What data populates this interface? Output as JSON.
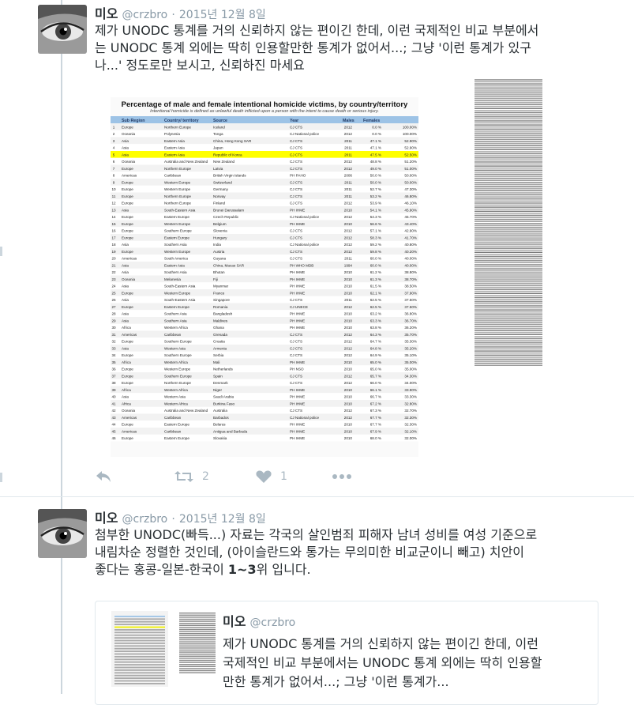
{
  "tweets": [
    {
      "name": "미오",
      "handle": "@crzbro",
      "date": "2015년 12월 8일",
      "lines": [
        "제가 UNODC 통계를 거의 신뢰하지 않는 편이긴 한데, 이런 국제적인 비교 부분에서",
        "는 UNODC 통계 외에는 딱히 인용할만한 통계가 없어서...; 그냥 '이런 통계가 있구",
        "나...' 정도로만 보시고, 신뢰하진 마세요"
      ],
      "retweets": "2",
      "likes": "1"
    },
    {
      "name": "미오",
      "handle": "@crzbro",
      "date": "2015년 12월 8일",
      "line1": "첨부한 UNODC(빠득...) 자료는 각국의 살인범죄 피해자 남녀 성비를 여성 기준으로",
      "line2": "내림차순 정렬한 것인데, (아이슬란드와 통가는 무의미한 비교군이니 빼고) 치안이",
      "line3_prefix": "좋다는 홍콩-일본-한국이 ",
      "line3_bold": "1~3",
      "line3_suffix": "위 입니다."
    }
  ],
  "quote": {
    "name": "미오",
    "handle": "@crzbro",
    "lines": [
      "제가 UNODC 통계를 거의 신뢰하지 않는 편이긴 한데, 이런",
      "국제적인 비교 부분에서는 UNODC 통계 외에는 딱히 인용할",
      "만한 통계가 없어서...; 그냥 '이런 통계가..."
    ]
  },
  "table": {
    "title": "Percentage of male and female intentional homicide victims, by country/territory",
    "subtitle": "Intentional homicide is defined as unlawful death inflicted upon a person with the intent to cause death or serious injury.",
    "headers": [
      "",
      "Sub Region",
      "Country/ territory",
      "Source",
      "Year",
      "Males",
      "Females"
    ],
    "highlight_row": 5,
    "rows": [
      [
        "1",
        "Europe",
        "Northern Europe",
        "Iceland",
        "CJ CTS",
        "2012",
        "0.0 %",
        "100.00%"
      ],
      [
        "2",
        "Oceania",
        "Polynesia",
        "Tonga",
        "CJ National police",
        "2012",
        "0.0 %",
        "100.00%"
      ],
      [
        "3",
        "Asia",
        "Eastern Asia",
        "China, Hong Kong SAR",
        "CJ CTS",
        "2011",
        "47.1 %",
        "52.90%"
      ],
      [
        "4",
        "Asia",
        "Eastern Asia",
        "Japan",
        "CJ CTS",
        "2011",
        "47.1 %",
        "52.90%"
      ],
      [
        "5",
        "Asia",
        "Eastern Asia",
        "Republic of Korea",
        "CJ CTS",
        "2011",
        "47.5 %",
        "52.50%"
      ],
      [
        "6",
        "Oceania",
        "Australia and New Zealand",
        "New Zealand",
        "CJ CTS",
        "2012",
        "48.8 %",
        "51.20%"
      ],
      [
        "7",
        "Europe",
        "Northern Europe",
        "Latvia",
        "CJ CTS",
        "2012",
        "49.0 %",
        "51.00%"
      ],
      [
        "8",
        "Americas",
        "Caribbean",
        "British Virgin Islands",
        "PH PAHO",
        "2006",
        "50.0 %",
        "50.00%"
      ],
      [
        "9",
        "Europe",
        "Western Europe",
        "Switzerland",
        "CJ CTS",
        "2011",
        "50.0 %",
        "50.00%"
      ],
      [
        "10",
        "Europe",
        "Western Europe",
        "Germany",
        "CJ CTS",
        "2011",
        "52.7 %",
        "47.30%"
      ],
      [
        "11",
        "Europe",
        "Northern Europe",
        "Norway",
        "CJ CTS",
        "2011",
        "53.2 %",
        "46.80%"
      ],
      [
        "12",
        "Europe",
        "Northern Europe",
        "Finland",
        "CJ CTS",
        "2012",
        "53.9 %",
        "46.10%"
      ],
      [
        "13",
        "Asia",
        "South-Eastern Asia",
        "Brunei Darussalam",
        "PH IHME",
        "2010",
        "54.1 %",
        "45.90%"
      ],
      [
        "14",
        "Europe",
        "Eastern Europe",
        "Czech Republic",
        "CJ National police",
        "2012",
        "54.3 %",
        "45.70%"
      ],
      [
        "15",
        "Europe",
        "Western Europe",
        "Belgium",
        "PH IHME",
        "2010",
        "56.6 %",
        "43.40%"
      ],
      [
        "16",
        "Europe",
        "Southern Europe",
        "Slovenia",
        "CJ CTS",
        "2012",
        "57.1 %",
        "42.90%"
      ],
      [
        "17",
        "Europe",
        "Eastern Europe",
        "Hungary",
        "CJ CTS",
        "2012",
        "58.3 %",
        "41.70%"
      ],
      [
        "18",
        "Asia",
        "Southern Asia",
        "India",
        "CJ National police",
        "2012",
        "59.2 %",
        "40.80%"
      ],
      [
        "19",
        "Europe",
        "Western Europe",
        "Austria",
        "CJ CTS",
        "2012",
        "59.8 %",
        "40.20%"
      ],
      [
        "20",
        "Americas",
        "South America",
        "Guyana",
        "CJ CTS",
        "2011",
        "60.0 %",
        "40.00%"
      ],
      [
        "21",
        "Asia",
        "Eastern Asia",
        "China, Macao SAR",
        "PH WHO MDB",
        "1994",
        "60.0 %",
        "40.00%"
      ],
      [
        "22",
        "Asia",
        "Southern Asia",
        "Bhutan",
        "PH IHME",
        "2010",
        "61.2 %",
        "38.80%"
      ],
      [
        "23",
        "Oceania",
        "Melanesia",
        "Fiji",
        "PH IHME",
        "2010",
        "61.3 %",
        "38.70%"
      ],
      [
        "24",
        "Asia",
        "South-Eastern Asia",
        "Myanmar",
        "PH IHME",
        "2010",
        "61.5 %",
        "38.50%"
      ],
      [
        "25",
        "Europe",
        "Western Europe",
        "France",
        "PH IHME",
        "2010",
        "62.1 %",
        "37.90%"
      ],
      [
        "26",
        "Asia",
        "South-Eastern Asia",
        "Singapore",
        "CJ CTS",
        "2011",
        "62.5 %",
        "37.50%"
      ],
      [
        "27",
        "Europe",
        "Eastern Europe",
        "Romania",
        "CJ UNECE",
        "2012",
        "62.5 %",
        "37.50%"
      ],
      [
        "28",
        "Asia",
        "Southern Asia",
        "Bangladesh",
        "PH IHME",
        "2010",
        "63.2 %",
        "36.80%"
      ],
      [
        "29",
        "Asia",
        "Southern Asia",
        "Maldives",
        "PH IHME",
        "2010",
        "63.3 %",
        "36.70%"
      ],
      [
        "30",
        "Africa",
        "Western Africa",
        "Ghana",
        "PH IHME",
        "2010",
        "63.8 %",
        "36.20%"
      ],
      [
        "31",
        "Americas",
        "Caribbean",
        "Grenada",
        "CJ CTS",
        "2012",
        "64.3 %",
        "35.70%"
      ],
      [
        "32",
        "Europe",
        "Southern Europe",
        "Croatia",
        "CJ CTS",
        "2012",
        "64.7 %",
        "35.30%"
      ],
      [
        "33",
        "Asia",
        "Western Asia",
        "Armenia",
        "CJ CTS",
        "2012",
        "64.8 %",
        "35.20%"
      ],
      [
        "34",
        "Europe",
        "Southern Europe",
        "Serbia",
        "CJ CTS",
        "2012",
        "64.9 %",
        "35.10%"
      ],
      [
        "35",
        "Africa",
        "Western Africa",
        "Mali",
        "PH IHME",
        "2010",
        "65.0 %",
        "35.00%"
      ],
      [
        "36",
        "Europe",
        "Western Europe",
        "Netherlands",
        "PH NSO",
        "2010",
        "65.0 %",
        "35.00%"
      ],
      [
        "37",
        "Europe",
        "Southern Europe",
        "Spain",
        "CJ CTS",
        "2012",
        "65.7 %",
        "34.30%"
      ],
      [
        "38",
        "Europe",
        "Northern Europe",
        "Denmark",
        "CJ CTS",
        "2012",
        "66.0 %",
        "34.00%"
      ],
      [
        "39",
        "Africa",
        "Western Africa",
        "Niger",
        "PH IHME",
        "2010",
        "66.1 %",
        "33.90%"
      ],
      [
        "40",
        "Asia",
        "Western Asia",
        "Saudi Arabia",
        "PH IHME",
        "2010",
        "66.7 %",
        "33.30%"
      ],
      [
        "41",
        "Africa",
        "Western Africa",
        "Burkina Faso",
        "PH IHME",
        "2010",
        "67.2 %",
        "32.80%"
      ],
      [
        "42",
        "Oceania",
        "Australia and New Zealand",
        "Australia",
        "CJ CTS",
        "2012",
        "67.3 %",
        "32.70%"
      ],
      [
        "43",
        "Americas",
        "Caribbean",
        "Barbados",
        "CJ National police",
        "2012",
        "67.7 %",
        "32.30%"
      ],
      [
        "44",
        "Europe",
        "Eastern Europe",
        "Belarus",
        "PH IHME",
        "2010",
        "67.7 %",
        "32.30%"
      ],
      [
        "45",
        "Americas",
        "Caribbean",
        "Antigua and Barbuda",
        "PH IHME",
        "2010",
        "67.9 %",
        "32.10%"
      ],
      [
        "46",
        "Europe",
        "Eastern Europe",
        "Slovakia",
        "PH IHME",
        "2010",
        "68.0 %",
        "32.00%"
      ]
    ]
  },
  "icons": {
    "reply": "reply-icon",
    "retweet": "retweet-icon",
    "like": "heart-icon",
    "more": "more-icon"
  },
  "colors": {
    "thread_line": "#ccd6dd",
    "handle": "#8899a6",
    "action": "#aab8c2",
    "table_header": "#9dc3e6",
    "highlight": "#ffff00"
  }
}
